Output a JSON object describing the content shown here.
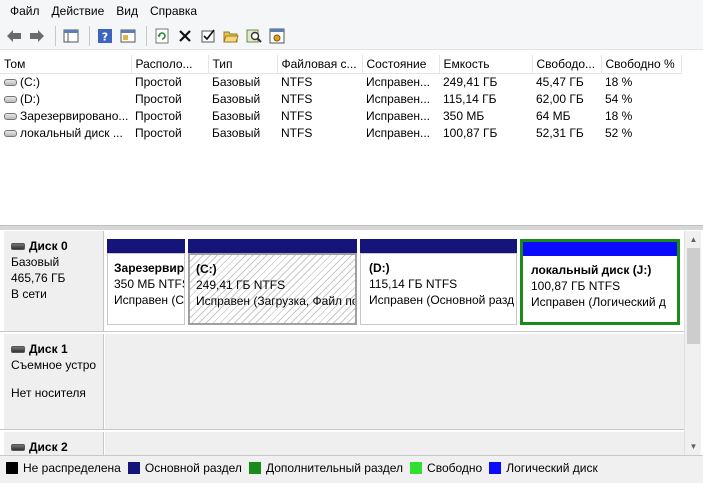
{
  "menu": [
    "Файл",
    "Действие",
    "Вид",
    "Справка"
  ],
  "toolbar": {
    "buttons": [
      {
        "name": "back-arrow-icon",
        "glyph": "⇦"
      },
      {
        "name": "forward-arrow-icon",
        "glyph": "⇨"
      },
      {
        "name": "console-tree-icon",
        "glyph": "▤"
      },
      {
        "name": "help-icon",
        "glyph": "?"
      },
      {
        "name": "properties-icon",
        "glyph": "▦"
      },
      {
        "name": "refresh-icon",
        "glyph": "⟳"
      },
      {
        "name": "delete-icon",
        "glyph": "✕"
      },
      {
        "name": "check-icon",
        "glyph": "☑"
      },
      {
        "name": "open-folder-icon",
        "glyph": "📂"
      },
      {
        "name": "search-icon",
        "glyph": "🔍"
      },
      {
        "name": "settings-icon",
        "glyph": "⚙"
      }
    ]
  },
  "volume_table": {
    "columns": [
      "Том",
      "Располо...",
      "Тип",
      "Файловая с...",
      "Состояние",
      "Емкость",
      "Свободо...",
      "Свободно %"
    ],
    "rows": [
      [
        "(C:)",
        "Простой",
        "Базовый",
        "NTFS",
        "Исправен...",
        "249,41 ГБ",
        "45,47 ГБ",
        "18 %"
      ],
      [
        "(D:)",
        "Простой",
        "Базовый",
        "NTFS",
        "Исправен...",
        "115,14 ГБ",
        "62,00 ГБ",
        "54 %"
      ],
      [
        "Зарезервировано...",
        "Простой",
        "Базовый",
        "NTFS",
        "Исправен...",
        "350 МБ",
        "64 МБ",
        "18 %"
      ],
      [
        "локальный диск ...",
        "Простой",
        "Базовый",
        "NTFS",
        "Исправен...",
        "100,87 ГБ",
        "52,31 ГБ",
        "52 %"
      ]
    ]
  },
  "disks": [
    {
      "title": "Диск 0",
      "lines": [
        "Базовый",
        "465,76 ГБ",
        "В сети"
      ],
      "partitions": [
        {
          "name": "Зарезервиро",
          "size": "350 МБ NTFS",
          "status": "Исправен (С"
        },
        {
          "name": "(C:)",
          "size": "249,41 ГБ NTFS",
          "status": "Исправен (Загрузка, Файл по"
        },
        {
          "name": "(D:)",
          "size": "115,14 ГБ NTFS",
          "status": "Исправен (Основной разд"
        },
        {
          "name": "локальный диск  (J:)",
          "size": "100,87 ГБ NTFS",
          "status": "Исправен (Логический д"
        }
      ]
    },
    {
      "title": "Диск 1",
      "lines": [
        "Съемное устро",
        "",
        "Нет носителя"
      ]
    },
    {
      "title": "Диск 2",
      "lines": []
    }
  ],
  "legend": [
    {
      "label": "Не распределена",
      "color": "#000000"
    },
    {
      "label": "Основной раздел",
      "color": "#14147a"
    },
    {
      "label": "Дополнительный раздел",
      "color": "#1a8a1a"
    },
    {
      "label": "Свободно",
      "color": "#33dd33"
    },
    {
      "label": "Логический диск",
      "color": "#0a0aff"
    }
  ]
}
